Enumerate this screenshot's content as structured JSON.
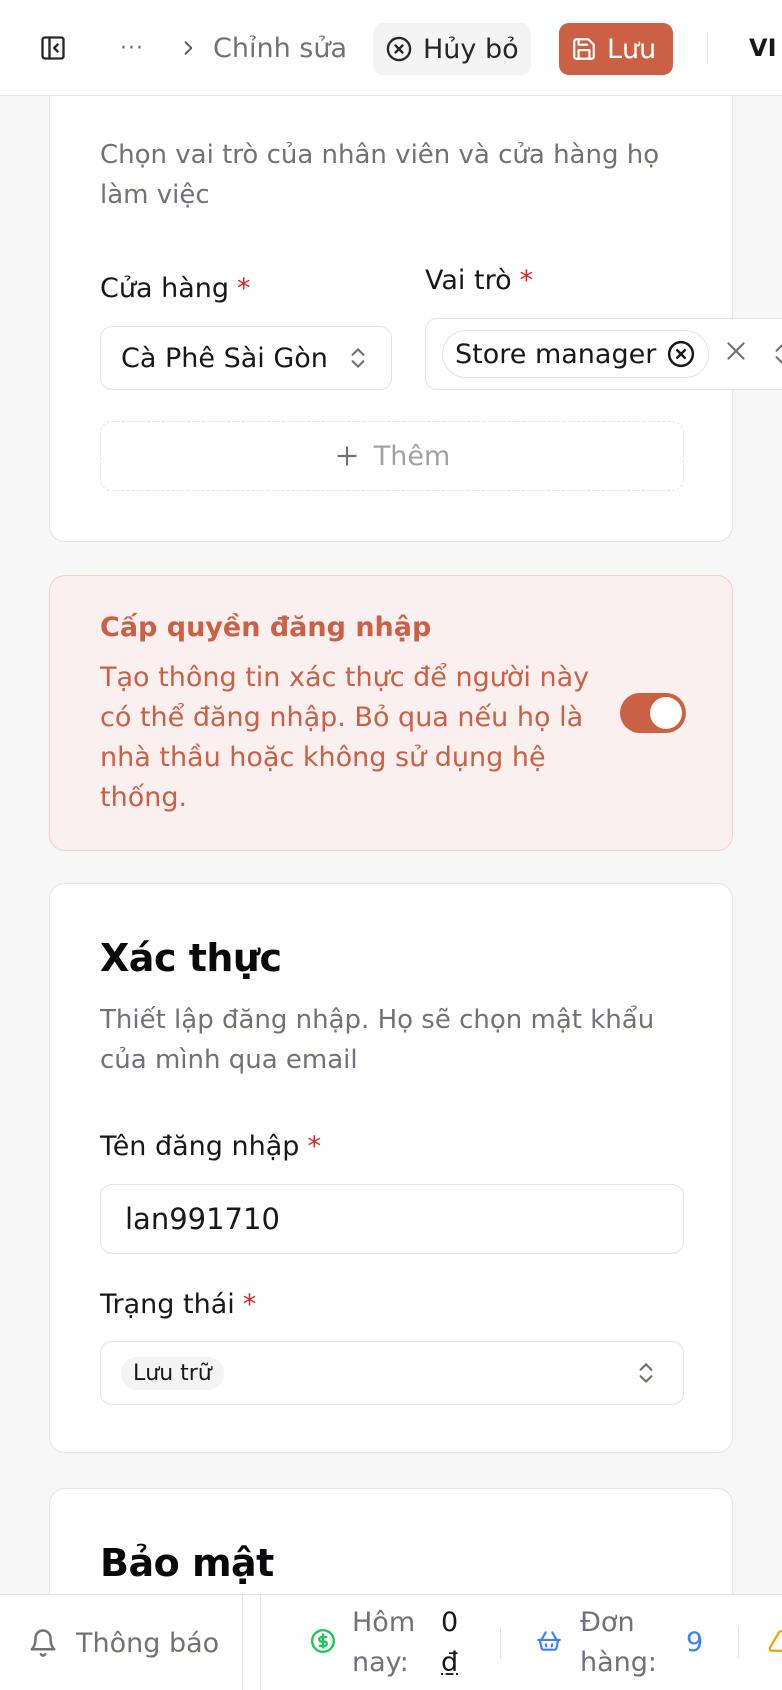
{
  "topbar": {
    "more": "···",
    "breadcrumb": "Chỉnh sửa",
    "cancel_label": "Hủy bỏ",
    "save_label": "Lưu",
    "lang": "VI"
  },
  "permissions": {
    "description": "Chọn vai trò của nhân viên và cửa hàng họ làm việc",
    "store_label": "Cửa hàng",
    "store_value": "Cà Phê Sài Gòn",
    "role_label": "Vai trò",
    "role_chip": "Store manager",
    "add_label": "Thêm",
    "required_mark": "*"
  },
  "login_access": {
    "title": "Cấp quyền đăng nhập",
    "description": "Tạo thông tin xác thực để người này có thể đăng nhập. Bỏ qua nếu họ là nhà thầu hoặc không sử dụng hệ thống.",
    "enabled": true
  },
  "auth": {
    "title": "Xác thực",
    "description": "Thiết lập đăng nhập. Họ sẽ chọn mật khẩu của mình qua email",
    "username_label": "Tên đăng nhập",
    "username_value": "lan991710",
    "status_label": "Trạng thái",
    "status_value": "Lưu trữ"
  },
  "security": {
    "title": "Bảo mật"
  },
  "bottombar": {
    "notifications": "Thông báo",
    "today_label_1": "Hôm",
    "today_label_2": "nay:",
    "today_value_1": "0",
    "today_value_2": "₫",
    "orders_label_1": "Đơn",
    "orders_label_2": "hàng:",
    "orders_value": "9"
  },
  "colors": {
    "accent": "#cc6045",
    "required": "#dc2626",
    "money_icon": "#22c55e",
    "orders_icon": "#3b82f6",
    "warning_icon": "#f59e0b"
  }
}
